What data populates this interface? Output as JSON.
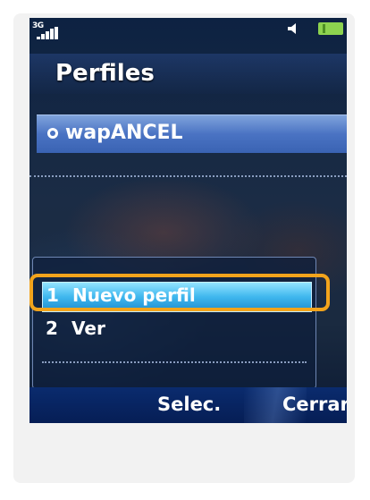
{
  "status": {
    "network_type": "3G",
    "signal_icon": "signal-strength-icon",
    "speaker_icon": "speaker-icon",
    "battery_icon": "battery-icon"
  },
  "screen": {
    "title": "Perfiles",
    "profiles": [
      {
        "label": "wapANCEL",
        "icon": "radio-selected-icon"
      }
    ]
  },
  "menu": {
    "items": [
      {
        "num": "1",
        "label": "Nuevo perfil"
      },
      {
        "num": "2",
        "label": "Ver"
      }
    ]
  },
  "softkeys": {
    "left": "Selec.",
    "right": "Cerrar"
  },
  "colors": {
    "highlight_ring": "#f2a41c",
    "selected_item": "#3fb7ee",
    "profile_row": "#4a73c3",
    "softkey_bar": "#0a2b6e"
  }
}
